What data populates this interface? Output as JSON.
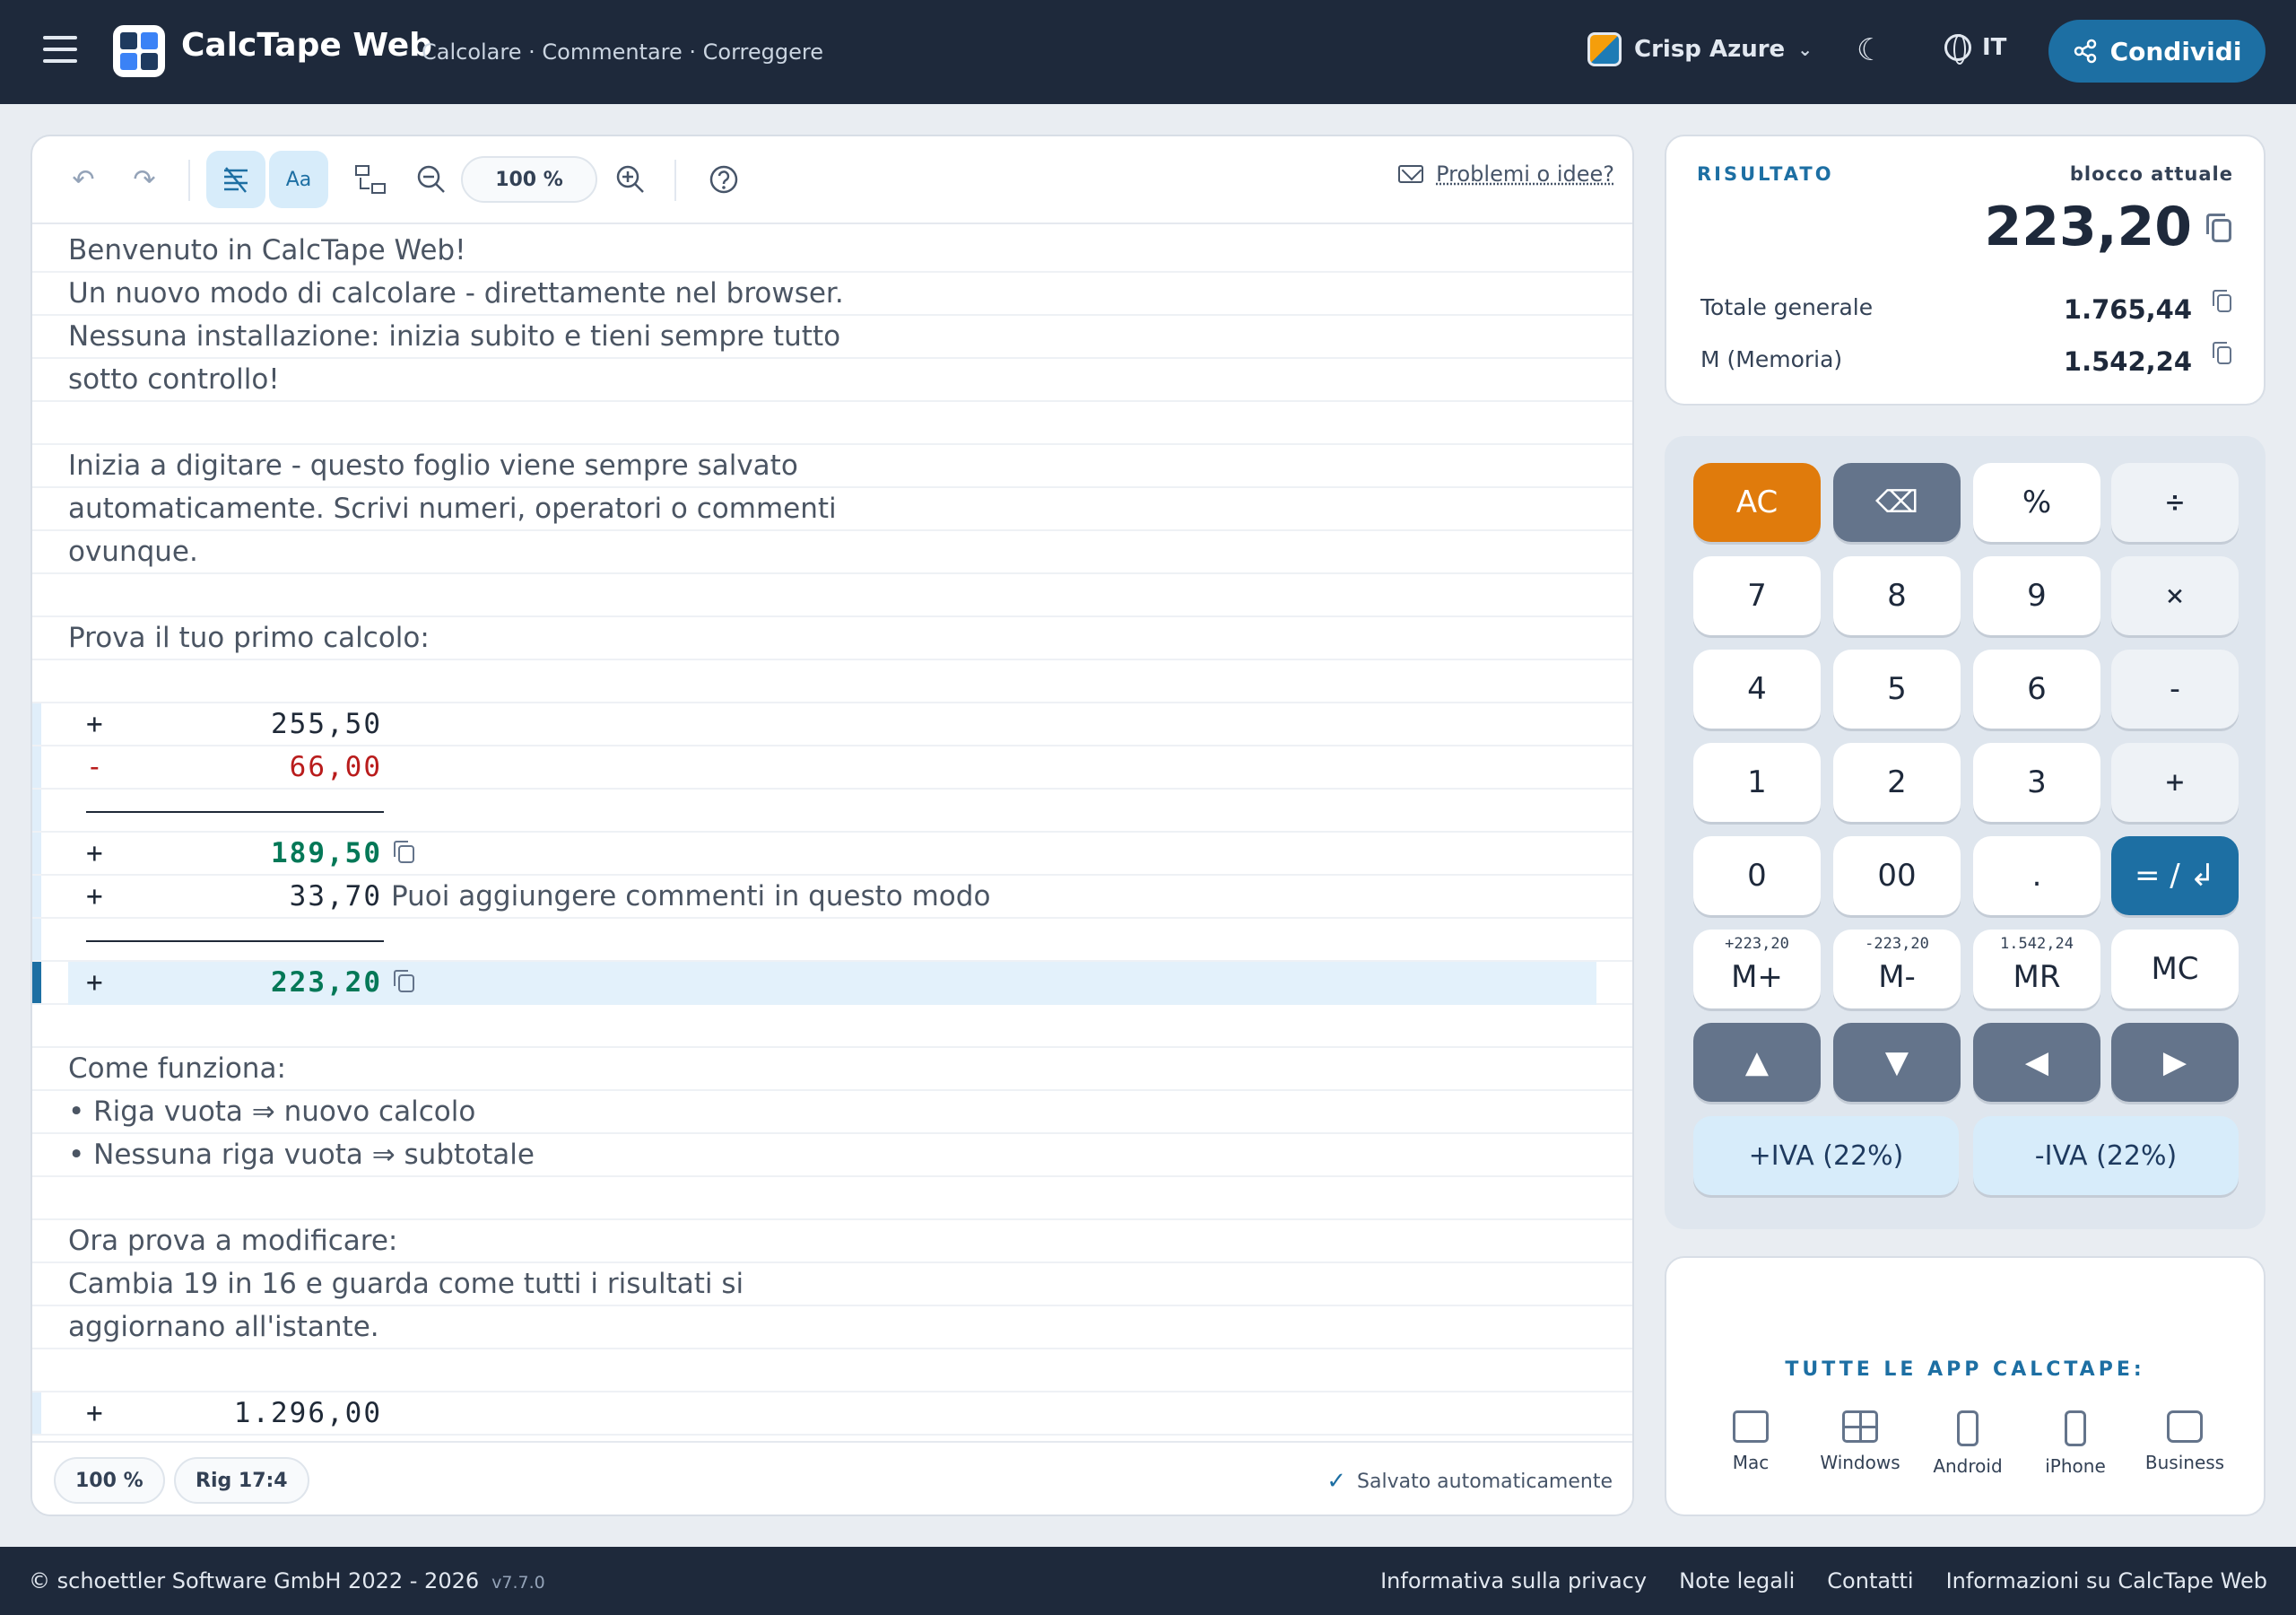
{
  "header": {
    "menu_icon": "hamburger-icon",
    "title": "CalcTape Web",
    "subtitle": "Calcolare · Commentare · Correggere",
    "theme_label": "Crisp Azure",
    "lang_label": "IT",
    "share_label": "Condividi"
  },
  "toolbar": {
    "zoom": "100 %",
    "feedback": "Problemi o idee?",
    "format_label": "Aa"
  },
  "editor": {
    "lines": [
      {
        "type": "text",
        "text": "Benvenuto in CalcTape Web!"
      },
      {
        "type": "text",
        "text": "Un nuovo modo di calcolare - direttamente nel browser."
      },
      {
        "type": "text",
        "text": "Nessuna installazione: inizia subito e tieni sempre tutto"
      },
      {
        "type": "text",
        "text": "sotto controllo!"
      },
      {
        "type": "text",
        "text": ""
      },
      {
        "type": "text",
        "text": "Inizia a digitare - questo foglio viene sempre salvato"
      },
      {
        "type": "text",
        "text": "automaticamente. Scrivi numeri, operatori o commenti"
      },
      {
        "type": "text",
        "text": "ovunque."
      },
      {
        "type": "text",
        "text": ""
      },
      {
        "type": "text",
        "text": "Prova il tuo primo calcolo:"
      },
      {
        "type": "text",
        "text": ""
      },
      {
        "type": "calc",
        "op": "+",
        "num": "255,50"
      },
      {
        "type": "calc",
        "op": "-",
        "num": "66,00",
        "neg": true
      },
      {
        "type": "rule"
      },
      {
        "type": "total",
        "op": "+",
        "num": "189,50"
      },
      {
        "type": "calc",
        "op": "+",
        "num": "33,70",
        "comment": "Puoi aggiungere commenti in questo modo"
      },
      {
        "type": "rule"
      },
      {
        "type": "total",
        "op": "+",
        "num": "223,20",
        "current": true
      },
      {
        "type": "text",
        "text": ""
      },
      {
        "type": "text",
        "text": "Come funziona:"
      },
      {
        "type": "text",
        "text": "• Riga vuota ⇒ nuovo calcolo"
      },
      {
        "type": "text",
        "text": "• Nessuna riga vuota ⇒ subtotale"
      },
      {
        "type": "text",
        "text": ""
      },
      {
        "type": "text",
        "text": "Ora prova a modificare:"
      },
      {
        "type": "text",
        "text": "Cambia 19 in 16 e guarda come tutti i risultati si"
      },
      {
        "type": "text",
        "text": "aggiornano all'istante."
      },
      {
        "type": "text",
        "text": ""
      },
      {
        "type": "calc",
        "op": "+",
        "num": "1.296,00"
      }
    ]
  },
  "status": {
    "zoom": "100 %",
    "position": "Rig 17:4",
    "saved": "Salvato automaticamente"
  },
  "result": {
    "label": "RISULTATO",
    "block_label": "blocco attuale",
    "value": "223,20",
    "grand_total_label": "Totale generale",
    "grand_total": "1.765,44",
    "memory_label": "M (Memoria)",
    "memory": "1.542,24"
  },
  "keypad": {
    "ac": "AC",
    "backspace": "⌫",
    "percent": "%",
    "divide": "÷",
    "k7": "7",
    "k8": "8",
    "k9": "9",
    "multiply": "×",
    "k4": "4",
    "k5": "5",
    "k6": "6",
    "minus": "-",
    "k1": "1",
    "k2": "2",
    "k3": "3",
    "plus": "+",
    "k0": "0",
    "k00": "00",
    "dot": ".",
    "equals": "= / ↲",
    "mplus": "M+",
    "mplus_hint": "+223,20",
    "mminus": "M-",
    "mminus_hint": "-223,20",
    "mr": "MR",
    "mr_hint": "1.542,24",
    "mc": "MC",
    "up": "▲",
    "down": "▼",
    "left": "◀",
    "right": "▶",
    "iva_plus": "+IVA (22%)",
    "iva_minus": "-IVA (22%)"
  },
  "apps": {
    "title": "TUTTE LE APP CALCTAPE:",
    "items": [
      "Mac",
      "Windows",
      "Android",
      "iPhone",
      "Business"
    ]
  },
  "footer": {
    "copyright": "© schoettler Software GmbH 2022 - 2026",
    "version": "v7.7.0",
    "links": [
      "Informativa sulla privacy",
      "Note legali",
      "Contatti",
      "Informazioni su CalcTape Web"
    ]
  },
  "colors": {
    "topbar": "#1e293b",
    "accent": "#1d6fa3",
    "ac_orange": "#e07b0c",
    "negative": "#b91c1c",
    "total_green": "#047857"
  }
}
